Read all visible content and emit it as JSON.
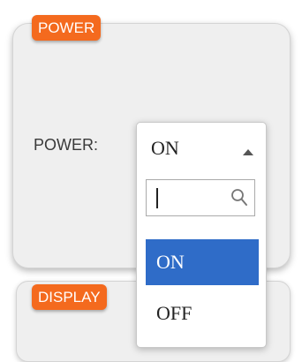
{
  "sections": {
    "power_tag": "POWER",
    "display_tag": "DISPLAY"
  },
  "power_field": {
    "label": "POWER:",
    "selected_value": "ON",
    "search_value": "",
    "options": [
      "ON",
      "OFF"
    ],
    "highlighted_option": "ON"
  },
  "colors": {
    "tag_orange": "#f46a1e",
    "highlight_blue": "#2f6cc8"
  },
  "icons": {
    "dropdown_open": "caret-up-icon",
    "search": "search-icon"
  }
}
